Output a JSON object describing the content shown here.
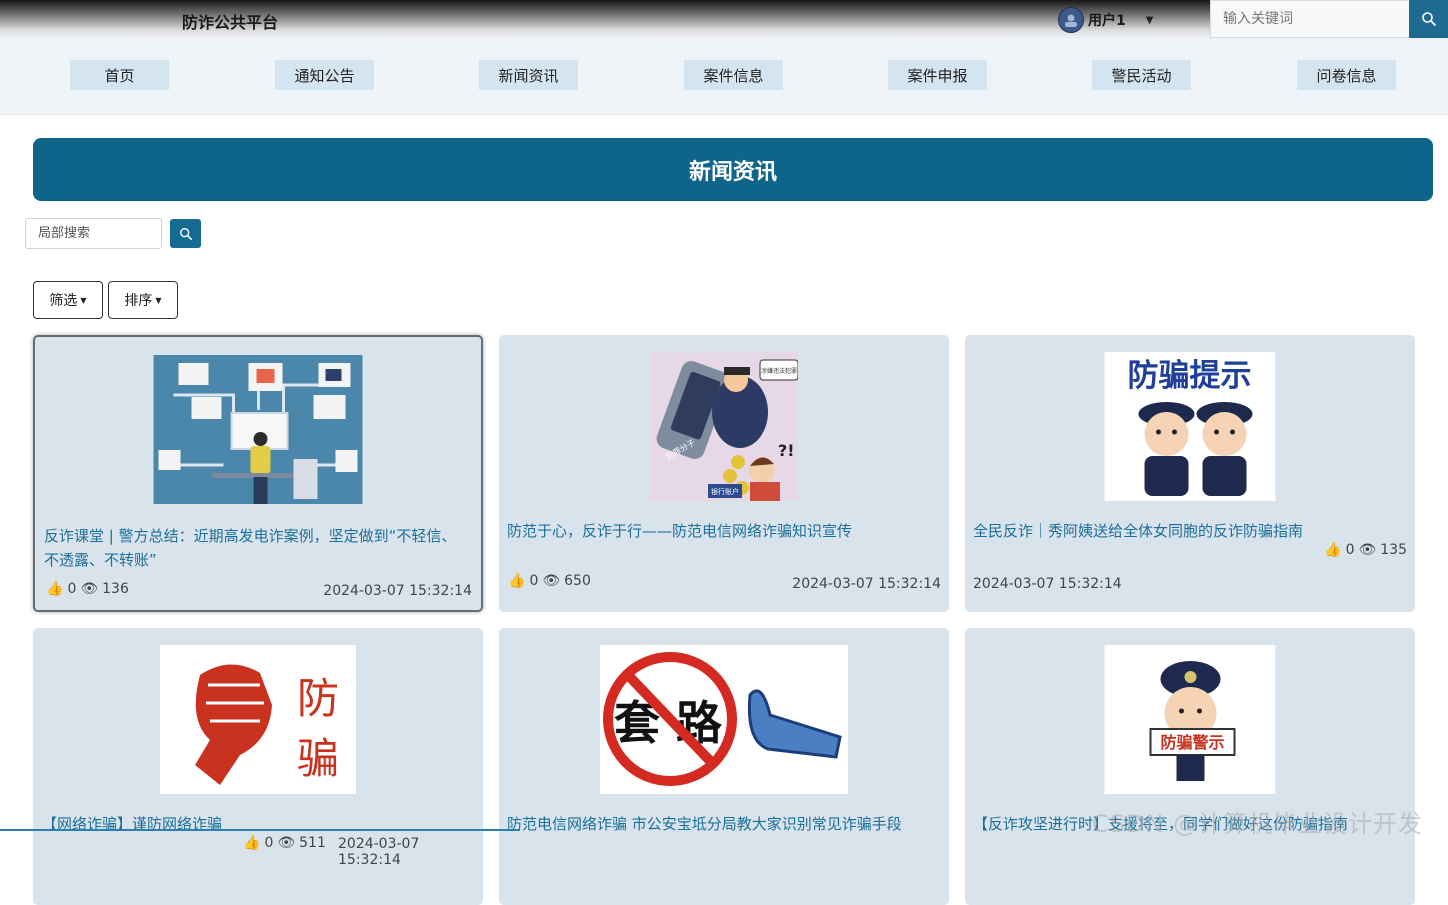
{
  "header": {
    "site_title": "防诈公共平台",
    "username": "用户1",
    "search_placeholder": "输入关键词"
  },
  "nav": {
    "items": [
      "首页",
      "通知公告",
      "新闻资讯",
      "案件信息",
      "案件申报",
      "警民活动",
      "问卷信息"
    ]
  },
  "page": {
    "banner_title": "新闻资讯",
    "local_search_placeholder": "局部搜索",
    "filter_label": "筛选",
    "sort_label": "排序"
  },
  "cards": [
    {
      "title": "反诈课堂 | 警方总结：近期高发电诈案例，坚定做到“不轻信、不透露、不转账”",
      "likes": "0",
      "views": "136",
      "date": "2024-03-07 15:32:14"
    },
    {
      "title": "防范于心，反诈于行——防范电信网络诈骗知识宣传",
      "likes": "0",
      "views": "650",
      "date": "2024-03-07 15:32:14"
    },
    {
      "title": "全民反诈｜秀阿姨送给全体女同胞的反诈防骗指南",
      "likes": "0",
      "views": "135",
      "date": "2024-03-07 15:32:14"
    },
    {
      "title": "【网络诈骗】谨防网络诈骗",
      "likes": "0",
      "views": "511",
      "date": "2024-03-07 15:32:14"
    },
    {
      "title": "防范电信网络诈骗 市公安宝坻分局教大家识别常见诈骗手段",
      "likes": "",
      "views": "",
      "date": ""
    },
    {
      "title": "【反诈攻坚进行时】支援将至，同学们做好这份防骗指南",
      "likes": "",
      "views": "",
      "date": ""
    }
  ],
  "image_text": {
    "poster3": "防骗提示",
    "poster4_a": "防",
    "poster4_b": "骗",
    "poster5": "套 路",
    "poster6": "防骗警示",
    "poster2_tag": "犯罪分子",
    "poster2_bubble": "涉嫌违法犯罪",
    "poster2_sign": "银行账户"
  },
  "watermark": "CSDN @计算机毕业设计开发",
  "colors": {
    "accent": "#0e6489",
    "card_bg": "#d8e3ec",
    "link": "#1c6f9a"
  }
}
